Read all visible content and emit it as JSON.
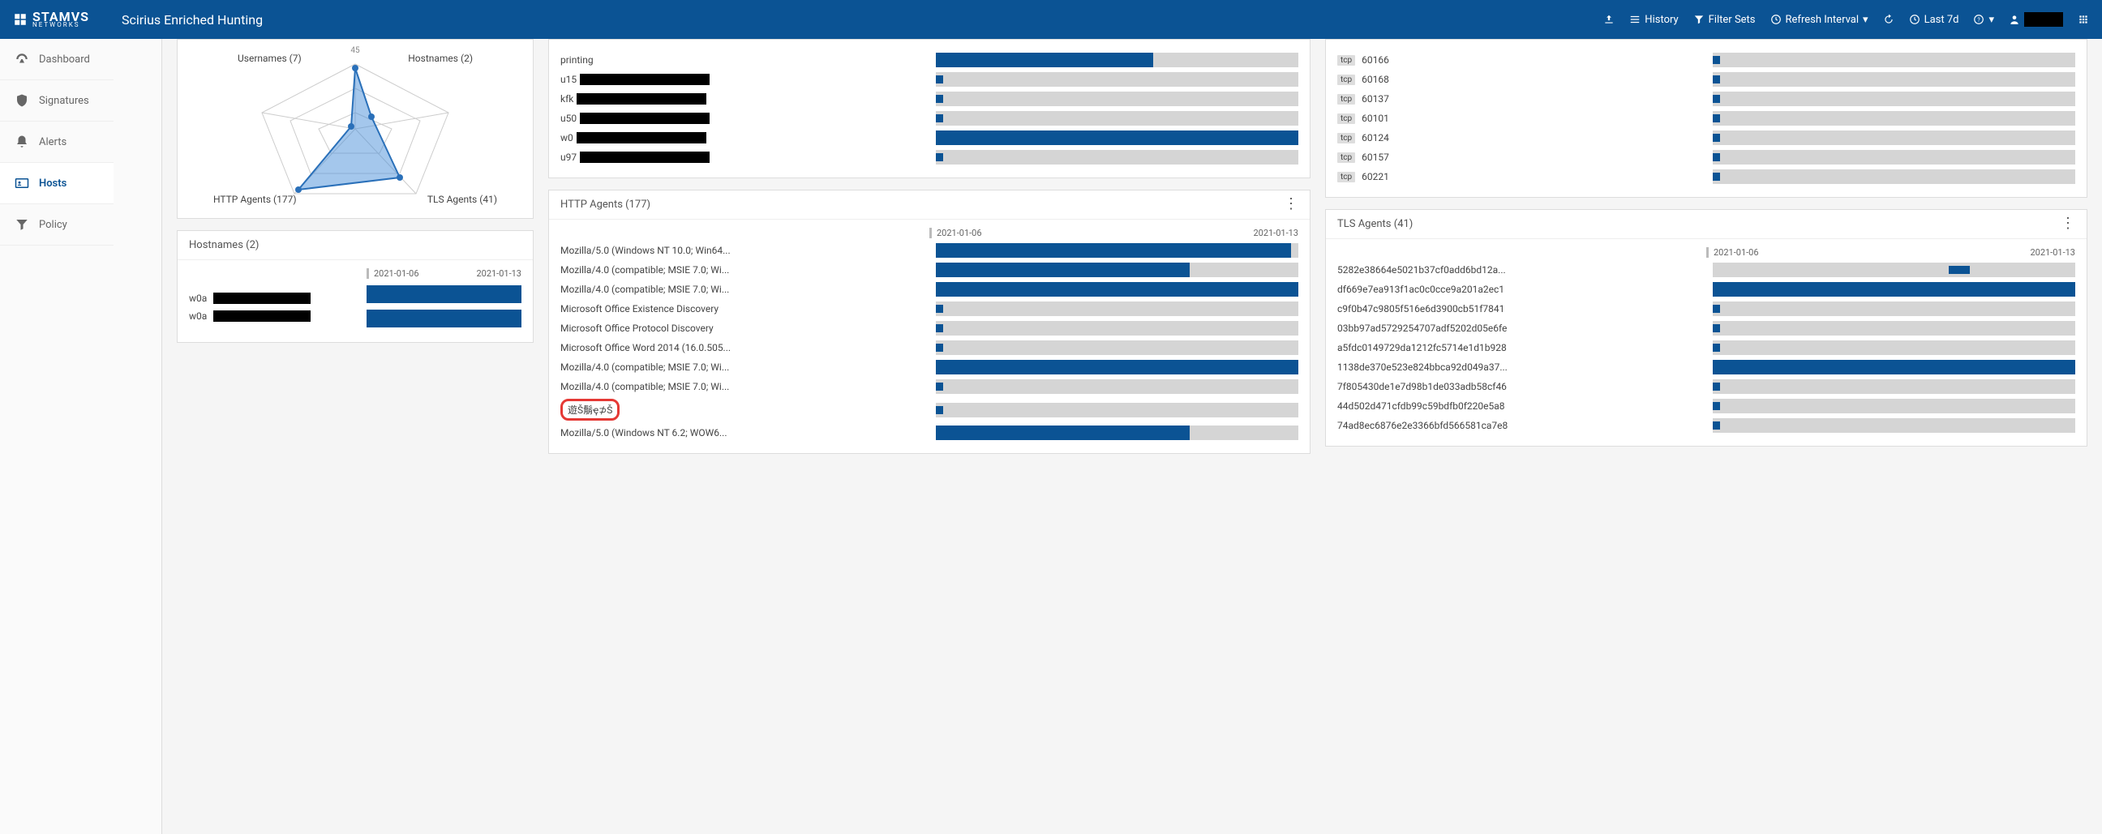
{
  "header": {
    "app_name": "STAMVS",
    "app_sub": "NETWORKS",
    "title": "Scirius Enriched Hunting",
    "actions": {
      "history": "History",
      "filter_sets": "Filter Sets",
      "refresh_interval": "Refresh Interval",
      "time_range": "Last 7d"
    }
  },
  "sidebar": {
    "items": [
      {
        "id": "dashboard",
        "label": "Dashboard",
        "active": false
      },
      {
        "id": "signatures",
        "label": "Signatures",
        "active": false
      },
      {
        "id": "alerts",
        "label": "Alerts",
        "active": false
      },
      {
        "id": "hosts",
        "label": "Hosts",
        "active": true
      },
      {
        "id": "policy",
        "label": "Policy",
        "active": false
      }
    ]
  },
  "chart_data": {
    "radar": {
      "type": "radar",
      "center_value": "45",
      "axes": [
        {
          "label": "Usernames (7)",
          "value": 7
        },
        {
          "label": "Hostnames (2)",
          "value": 2
        },
        {
          "label": "TLS Agents (41)",
          "value": 41
        },
        {
          "label": "HTTP Agents (177)",
          "value": 177
        }
      ]
    }
  },
  "hostnames_panel": {
    "title": "Hostnames (2)",
    "date_start": "2021-01-06",
    "date_end": "2021-01-13",
    "rows": [
      {
        "label_prefix": "w0a",
        "redacted": true,
        "fill": 100
      },
      {
        "label_prefix": "w0a",
        "redacted": true,
        "fill": 100
      }
    ]
  },
  "unnamed_list": {
    "rows": [
      {
        "prefix": "printing",
        "redacted": false,
        "fill": 60,
        "bg": 100
      },
      {
        "prefix": "u15",
        "redacted": true,
        "fill": 2,
        "bg": 100,
        "thin": true
      },
      {
        "prefix": "kfk",
        "redacted": true,
        "fill": 2,
        "bg": 100,
        "thin": true
      },
      {
        "prefix": "u50",
        "redacted": true,
        "fill": 2,
        "bg": 100,
        "thin": true
      },
      {
        "prefix": "w0",
        "redacted": true,
        "fill": 100,
        "bg": 100
      },
      {
        "prefix": "u97",
        "redacted": true,
        "fill": 2,
        "bg": 100,
        "thin": true
      }
    ]
  },
  "http_agents": {
    "title": "HTTP Agents (177)",
    "date_start": "2021-01-06",
    "date_end": "2021-01-13",
    "rows": [
      {
        "label": "Mozilla/5.0 (Windows NT 10.0; Win64...",
        "fill": 98
      },
      {
        "label": "Mozilla/4.0 (compatible; MSIE 7.0; Wi...",
        "fill": 70,
        "bg": 100
      },
      {
        "label": "Mozilla/4.0 (compatible; MSIE 7.0; Wi...",
        "fill": 100
      },
      {
        "label": "Microsoft Office Existence Discovery",
        "fill": 2,
        "thin": true
      },
      {
        "label": "Microsoft Office Protocol Discovery",
        "fill": 2,
        "thin": true
      },
      {
        "label": "Microsoft Office Word 2014 (16.0.505...",
        "fill": 2,
        "thin": true
      },
      {
        "label": "Mozilla/4.0 (compatible; MSIE 7.0; Wi...",
        "fill": 100
      },
      {
        "label": "Mozilla/4.0 (compatible; MSIE 7.0; Wi...",
        "fill": 2,
        "thin": true
      },
      {
        "label": "遊Š鬅ҿ⊅Š",
        "fill": 2,
        "thin": true,
        "highlight": true
      },
      {
        "label": "Mozilla/5.0 (Windows NT 6.2; WOW6...",
        "fill": 70,
        "bg": 100
      }
    ]
  },
  "tcp_ports": {
    "rows": [
      {
        "proto": "tcp",
        "port": "60166",
        "fill": 2,
        "thin": true
      },
      {
        "proto": "tcp",
        "port": "60168",
        "fill": 2,
        "thin": true
      },
      {
        "proto": "tcp",
        "port": "60137",
        "fill": 2,
        "thin": true
      },
      {
        "proto": "tcp",
        "port": "60101",
        "fill": 2,
        "thin": true
      },
      {
        "proto": "tcp",
        "port": "60124",
        "fill": 2,
        "thin": true
      },
      {
        "proto": "tcp",
        "port": "60157",
        "fill": 2,
        "thin": true
      },
      {
        "proto": "tcp",
        "port": "60221",
        "fill": 2,
        "thin": true
      }
    ]
  },
  "tls_agents": {
    "title": "TLS Agents (41)",
    "date_start": "2021-01-06",
    "date_end": "2021-01-13",
    "rows": [
      {
        "label": "5282e38664e5021b37cf0add6bd12a...",
        "fill": 6,
        "thin": true,
        "offset": 65
      },
      {
        "label": "df669e7ea913f1ac0c0cce9a201a2ec1",
        "fill": 100
      },
      {
        "label": "c9f0b47c9805f516e6d3900cb51f7841",
        "fill": 2,
        "thin": true
      },
      {
        "label": "03bb97ad5729254707adf5202d05e6fe",
        "fill": 2,
        "thin": true
      },
      {
        "label": "a5fdc0149729da1212fc5714e1d1b928",
        "fill": 2,
        "thin": true
      },
      {
        "label": "1138de370e523e824bbca92d049a37...",
        "fill": 100
      },
      {
        "label": "7f805430de1e7d98b1de033adb58cf46",
        "fill": 2,
        "thin": true
      },
      {
        "label": "44d502d471cfdb99c59bdfb0f220e5a8",
        "fill": 2,
        "thin": true
      },
      {
        "label": "74ad8ec6876e2e3366bfd566581ca7e8",
        "fill": 2,
        "thin": true
      }
    ]
  }
}
